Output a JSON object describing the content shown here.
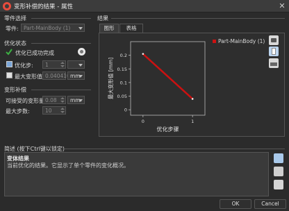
{
  "window": {
    "title": "变形补偿的结果 - 属性"
  },
  "parts": {
    "section": "零件选择",
    "part_label": "零件:",
    "part_value": "Part-MainBody (1)"
  },
  "optimization": {
    "section": "优化状态",
    "status_text": "优化已成功完成",
    "step_label": "优化步:",
    "step_value": "1",
    "max_deform_label": "最大变形值:",
    "max_deform_value": "0.040410",
    "unit": "mm"
  },
  "compensation": {
    "section": "变形补偿",
    "acceptable_label": "可接受的变形量:",
    "acceptable_value": "0.08",
    "acceptable_unit": "mm",
    "max_steps_label": "最大步数:",
    "max_steps_value": "10"
  },
  "results": {
    "section": "结果",
    "tabs": [
      {
        "label": "图形"
      },
      {
        "label": "表格"
      }
    ],
    "legend_label": "Part-MainBody (1)"
  },
  "chart_data": {
    "type": "line",
    "x": [
      0,
      1
    ],
    "series": [
      {
        "name": "Part-MainBody (1)",
        "values": [
          0.205,
          0.04
        ],
        "color": "#cc1111"
      }
    ],
    "xlabel": "优化步骤",
    "ylabel": "最大变形值 [mm]",
    "xticks": [
      "0",
      "1"
    ],
    "yticks": [
      "0",
      "0.05",
      "0.1",
      "0.15",
      "0.2"
    ],
    "xlim": [
      -0.25,
      1.25
    ],
    "ylim": [
      -0.02,
      0.25
    ]
  },
  "description": {
    "section": "简述 (按下Ctrl键以锁定)",
    "title": "变体结果",
    "body": "当前优化的结果。它显示了单个零件的变化概况。"
  },
  "buttons": {
    "ok": "OK",
    "cancel": "Cancel"
  },
  "colors": {
    "accent": "#cc1111",
    "success": "#3cb043",
    "background": "#2b2b2b"
  }
}
